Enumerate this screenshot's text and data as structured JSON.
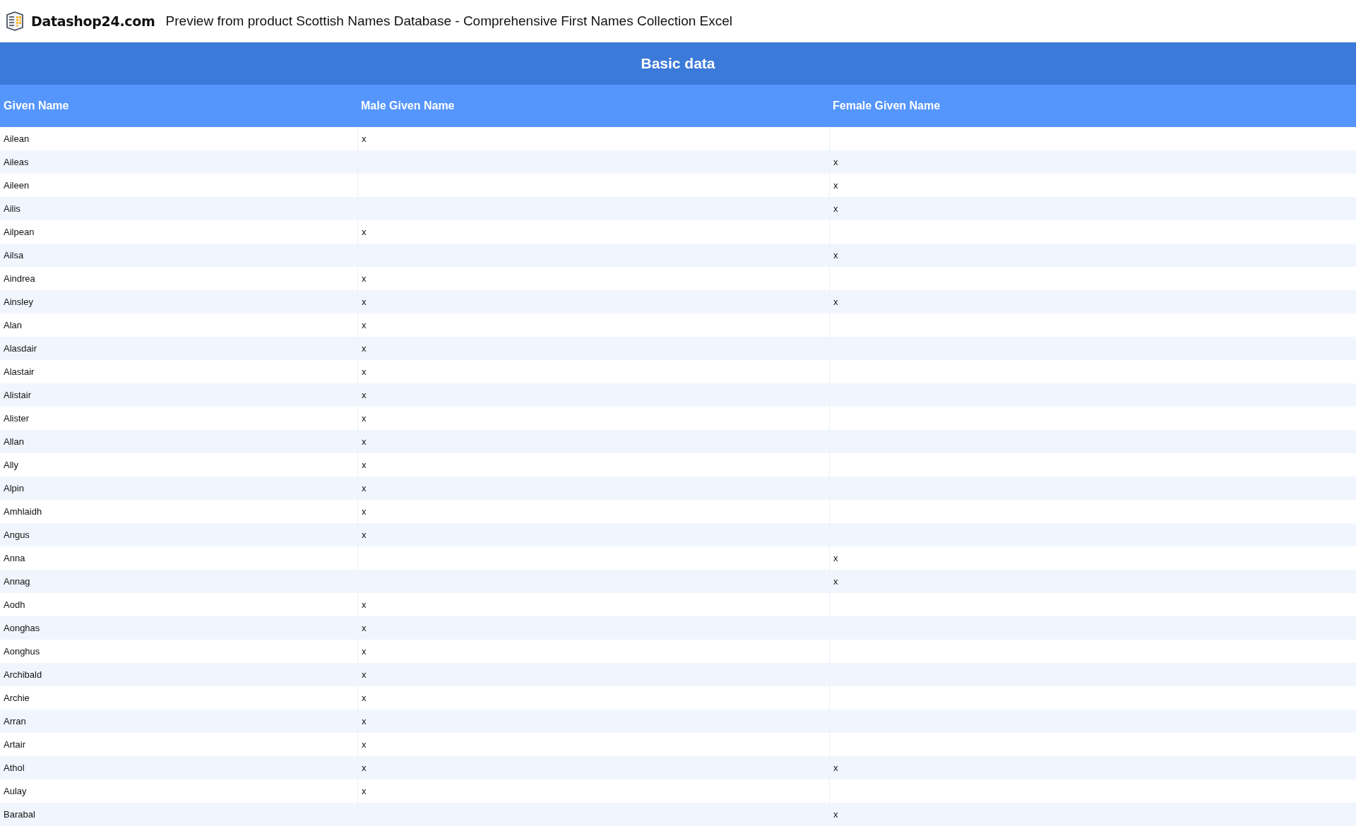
{
  "header": {
    "logo_text": "Datashop24.com",
    "title": "Preview from product Scottish Names Database - Comprehensive First Names Collection Excel"
  },
  "section": {
    "title": "Basic data"
  },
  "table": {
    "columns": [
      "Given Name",
      "Male Given Name",
      "Female Given Name"
    ],
    "rows": [
      {
        "given": "Ailean",
        "male": "x"
      },
      {
        "given": "Aileas",
        "female": "x"
      },
      {
        "given": "Aileen",
        "female": "x"
      },
      {
        "given": "Ailis",
        "female": "x"
      },
      {
        "given": "Ailpean",
        "male": "x"
      },
      {
        "given": "Ailsa",
        "female": "x"
      },
      {
        "given": "Aindrea",
        "male": "x"
      },
      {
        "given": "Ainsley",
        "male": "x",
        "female": "x"
      },
      {
        "given": "Alan",
        "male": "x"
      },
      {
        "given": "Alasdair",
        "male": "x"
      },
      {
        "given": "Alastair",
        "male": "x"
      },
      {
        "given": "Alistair",
        "male": "x"
      },
      {
        "given": "Alister",
        "male": "x"
      },
      {
        "given": "Allan",
        "male": "x"
      },
      {
        "given": "Ally",
        "male": "x"
      },
      {
        "given": "Alpin",
        "male": "x"
      },
      {
        "given": "Amhlaidh",
        "male": "x"
      },
      {
        "given": "Angus",
        "male": "x"
      },
      {
        "given": "Anna",
        "female": "x"
      },
      {
        "given": "Annag",
        "female": "x"
      },
      {
        "given": "Aodh",
        "male": "x"
      },
      {
        "given": "Aonghas",
        "male": "x"
      },
      {
        "given": "Aonghus",
        "male": "x"
      },
      {
        "given": "Archibald",
        "male": "x"
      },
      {
        "given": "Archie",
        "male": "x"
      },
      {
        "given": "Arran",
        "male": "x"
      },
      {
        "given": "Artair",
        "male": "x"
      },
      {
        "given": "Athol",
        "male": "x",
        "female": "x"
      },
      {
        "given": "Aulay",
        "male": "x"
      },
      {
        "given": "Barabal",
        "female": "x"
      }
    ]
  }
}
